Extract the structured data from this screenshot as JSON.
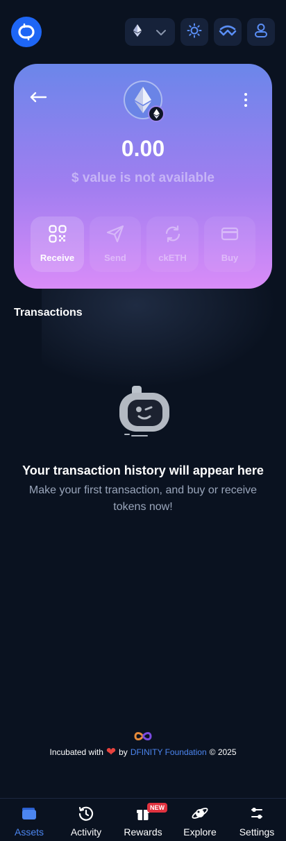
{
  "header": {
    "logo_icon": "oisy-logo-icon",
    "network_selector_icon": "ethereum-icon",
    "theme_icon": "sun-icon",
    "walletconnect_icon": "walletconnect-icon",
    "user_icon": "user-icon"
  },
  "token_card": {
    "back_icon": "arrow-left-icon",
    "more_icon": "more-vertical-icon",
    "token_icon": "ethereum-icon",
    "balance": "0.00",
    "value_note": "$ value is not available",
    "actions": [
      {
        "label": "Receive",
        "icon": "qr-code-icon",
        "enabled": true
      },
      {
        "label": "Send",
        "icon": "send-icon",
        "enabled": false
      },
      {
        "label": "ckETH",
        "icon": "convert-icon",
        "enabled": false
      },
      {
        "label": "Buy",
        "icon": "card-icon",
        "enabled": false
      }
    ],
    "colors": {
      "gradient_top": "#6b86ea",
      "gradient_bottom": "#d98cf8"
    }
  },
  "transactions": {
    "title": "Transactions",
    "empty_title": "Your transaction history will appear here",
    "empty_description": "Make your first transaction, and buy or receive tokens now!"
  },
  "footer": {
    "incubated_with": "Incubated with",
    "by": "by",
    "foundation": "DFINITY Foundation",
    "copyright": "© 2025"
  },
  "bottom_nav": {
    "items": [
      {
        "label": "Assets",
        "icon": "wallet-icon",
        "active": true
      },
      {
        "label": "Activity",
        "icon": "history-icon",
        "active": false
      },
      {
        "label": "Rewards",
        "icon": "gift-icon",
        "active": false,
        "badge": "NEW"
      },
      {
        "label": "Explore",
        "icon": "planet-icon",
        "active": false
      },
      {
        "label": "Settings",
        "icon": "sliders-icon",
        "active": false
      }
    ]
  },
  "colors": {
    "background": "#0a1220",
    "accent": "#4c86f0",
    "badge": "#e0323f"
  }
}
